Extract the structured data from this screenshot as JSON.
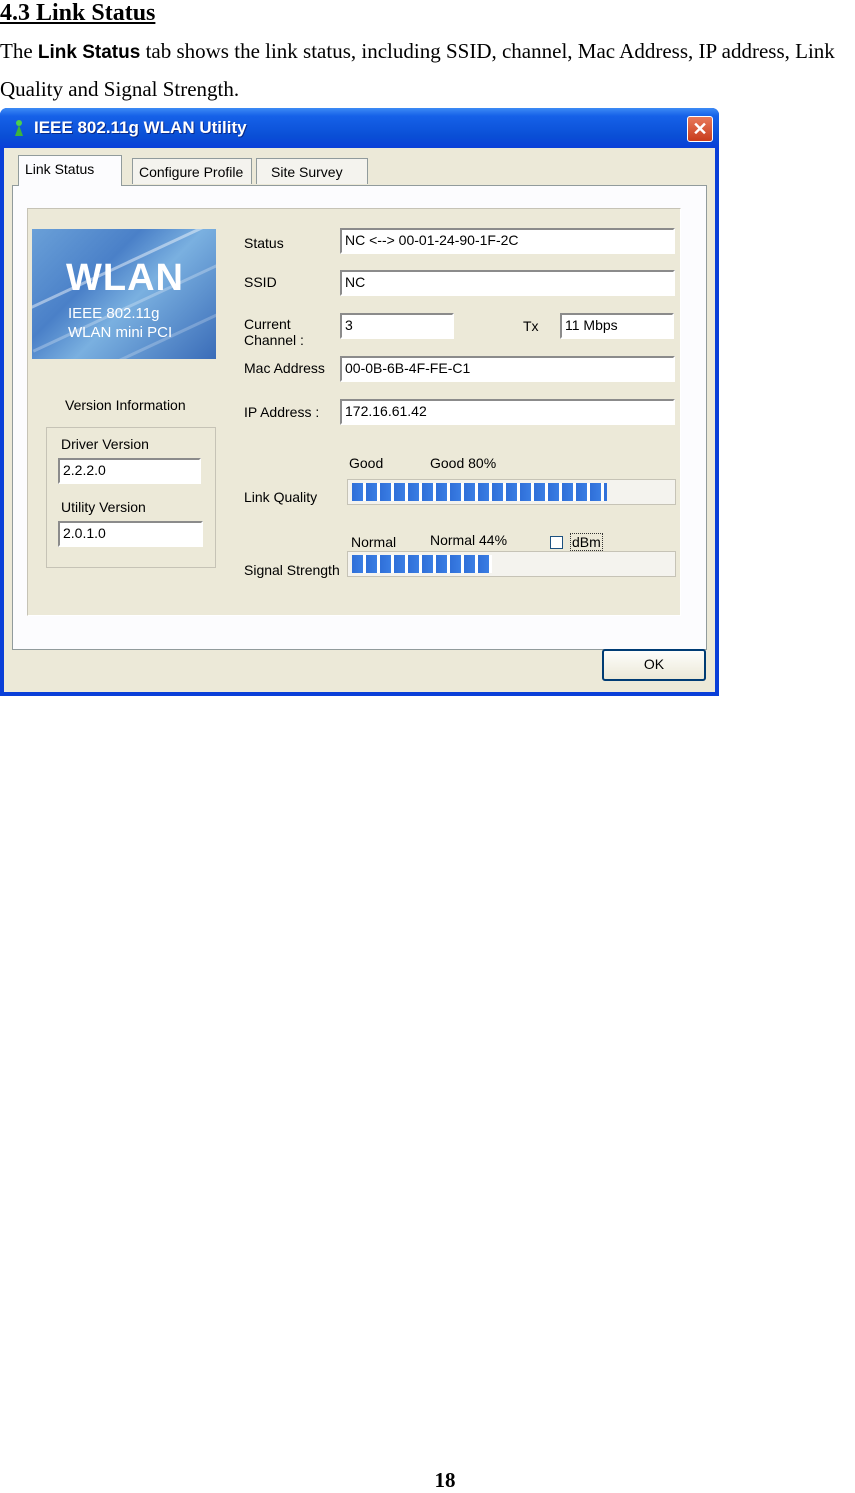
{
  "doc": {
    "heading": "4.3 Link Status",
    "para_prefix": "The ",
    "para_bold": "Link Status",
    "para_suffix": " tab shows the link status, including SSID, channel, Mac Address, IP address, Link Quality and Signal Strength.",
    "page_number": "18"
  },
  "window": {
    "title": "IEEE 802.11g WLAN Utility",
    "close_glyph": "✕",
    "title_icon": "wlan-antenna-icon"
  },
  "tabs": [
    {
      "label": "Link Status",
      "active": true
    },
    {
      "label": "Configure Profile",
      "active": false
    },
    {
      "label": "Site Survey",
      "active": false
    }
  ],
  "logo": {
    "big": "WLAN",
    "line2": "IEEE 802.11g",
    "line3": "WLAN mini PCI"
  },
  "version": {
    "group_label": "Version Information",
    "driver_label": "Driver Version",
    "driver_value": "2.2.2.0",
    "utility_label": "Utility Version",
    "utility_value": "2.0.1.0"
  },
  "fields": {
    "status_label": "Status",
    "status_value": "NC <--> 00-01-24-90-1F-2C",
    "ssid_label": "SSID",
    "ssid_value": "NC",
    "channel_label_1": "Current",
    "channel_label_2": "Channel :",
    "channel_value": "3",
    "tx_label": "Tx",
    "tx_value": "11 Mbps",
    "mac_label": "Mac Address",
    "mac_value": "00-0B-6B-4F-FE-C1",
    "ip_label": "IP Address :",
    "ip_value": "172.16.61.42"
  },
  "link_quality": {
    "label": "Link Quality",
    "state": "Good",
    "detail": "Good 80%",
    "percent": 80
  },
  "signal_strength": {
    "label": "Signal Strength",
    "state": "Normal",
    "detail": "Normal 44%",
    "percent": 44
  },
  "dbm_label": "dBm",
  "ok_label": "OK",
  "colors": {
    "title_blue": "#0a3fd8",
    "progress_blue": "#2f6fd8",
    "dialog_bg": "#ece9d8"
  }
}
